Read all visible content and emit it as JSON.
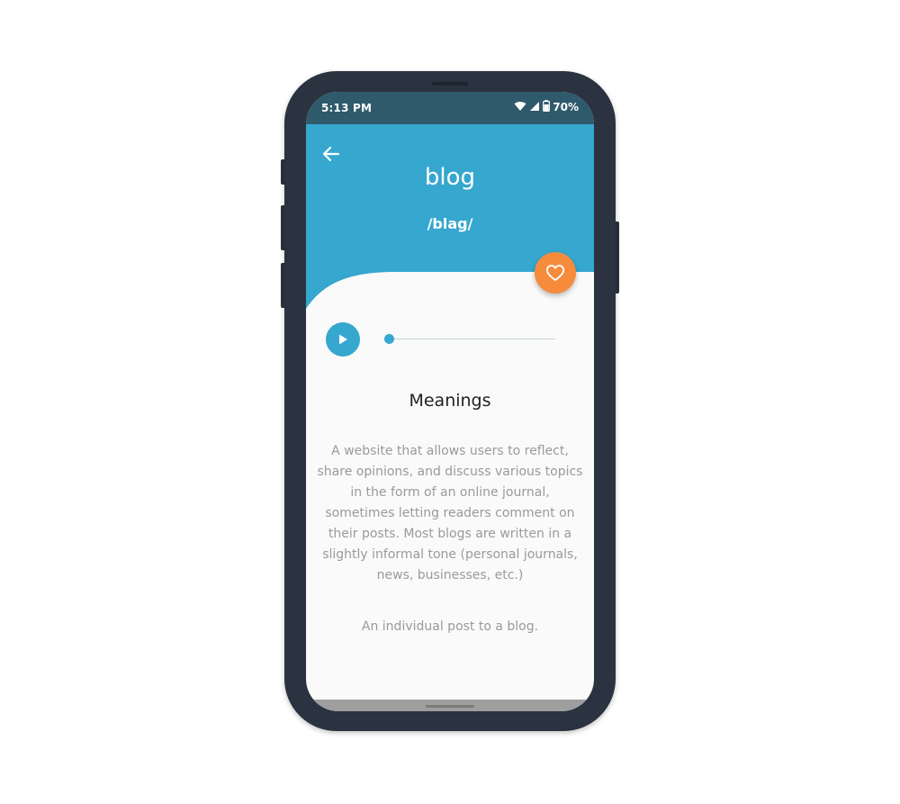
{
  "status_bar": {
    "time": "5:13 PM",
    "battery": "70%"
  },
  "header": {
    "word": "blog",
    "phonetic": "/blag/",
    "back_icon": "arrow-left-icon",
    "favorite_icon": "heart-outline-icon"
  },
  "audio": {
    "play_icon": "play-icon",
    "progress": 0
  },
  "content": {
    "section_title": "Meanings",
    "meanings": [
      "A website that allows users to reflect, share opinions, and discuss various topics in the form of an online journal, sometimes letting readers comment on their posts. Most blogs are written in a slightly informal tone (personal journals, news, businesses, etc.)",
      "An individual post to a blog."
    ]
  },
  "colors": {
    "accent": "#36a7ce",
    "favorite": "#f68b3c",
    "status_bar": "#2f5a6c",
    "phone_frame": "#2b3240"
  }
}
